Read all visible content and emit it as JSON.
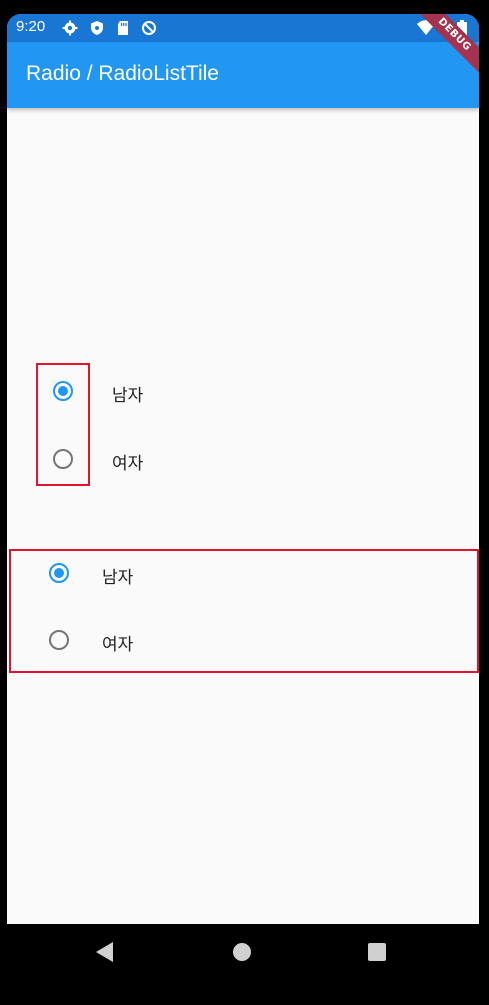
{
  "status_bar": {
    "time": "9:20",
    "icons": [
      "gear-icon",
      "shield-icon",
      "sd-card-icon",
      "no-sync-icon",
      "wifi-icon",
      "battery-icon"
    ]
  },
  "app_bar": {
    "title": "Radio / RadioListTile",
    "debug_banner": "DEBUG"
  },
  "radio_group": {
    "options": [
      {
        "label": "남자",
        "selected": true
      },
      {
        "label": "여자",
        "selected": false
      }
    ]
  },
  "radio_list_tile_group": {
    "options": [
      {
        "label": "남자",
        "selected": true
      },
      {
        "label": "여자",
        "selected": false
      }
    ]
  },
  "colors": {
    "primary": "#2196f3",
    "status_bar": "#1976d2",
    "radio_active": "#2196f3",
    "radio_inactive": "#757575",
    "highlight_border": "#e3132c"
  },
  "nav_bar": {
    "buttons": [
      "back-icon",
      "home-icon",
      "recents-icon"
    ]
  }
}
